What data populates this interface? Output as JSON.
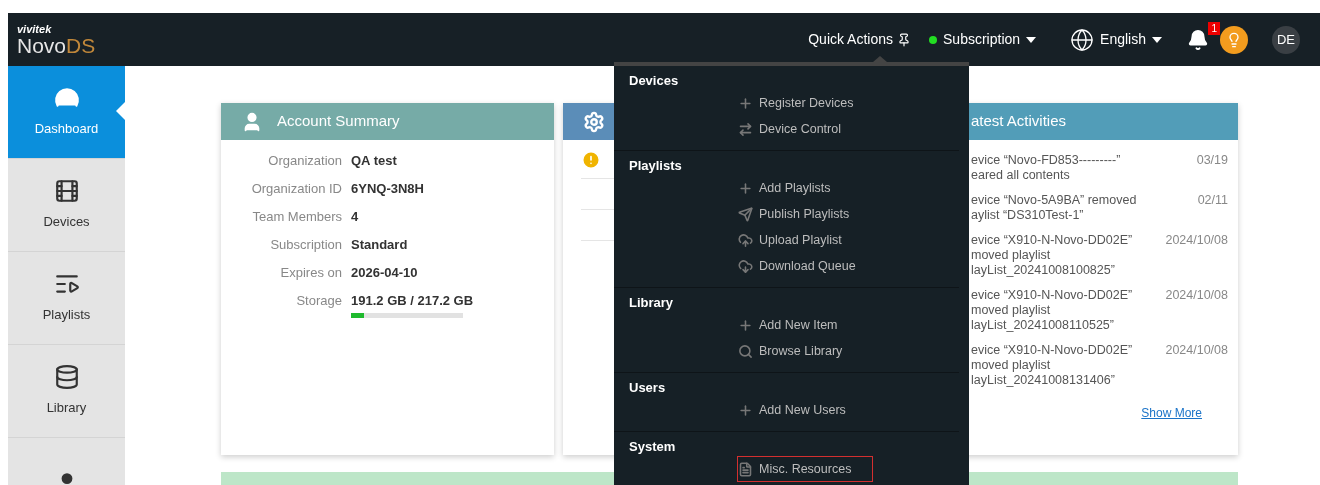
{
  "header": {
    "logo_top": "vivitek",
    "logo_main": "Novo",
    "logo_accent": "DS",
    "quick_actions": "Quick Actions",
    "subscription": "Subscription",
    "language": "English",
    "notification_count": "1",
    "user_initials": "DE"
  },
  "sidebar": {
    "items": [
      {
        "label": "Dashboard",
        "selected": true
      },
      {
        "label": "Devices",
        "selected": false
      },
      {
        "label": "Playlists",
        "selected": false
      },
      {
        "label": "Library",
        "selected": false
      },
      {
        "selected": false
      }
    ]
  },
  "account_summary": {
    "title": "Account Summary",
    "fields": [
      {
        "label": "Organization",
        "value": "QA test"
      },
      {
        "label": "Organization ID",
        "value": "6YNQ-3N8H"
      },
      {
        "label": "Team Members",
        "value": "4"
      },
      {
        "label": "Subscription",
        "value": "Standard"
      },
      {
        "label": "Expires on",
        "value": "2026-04-10"
      },
      {
        "label": "Storage",
        "value": "191.2 GB / 217.2 GB",
        "level": 0.12
      }
    ]
  },
  "latest_activities": {
    "title": "atest Activities",
    "items": [
      {
        "text": "evice “Novo-FD853---------”\neared all contents",
        "date": "03/19"
      },
      {
        "text": "evice “Novo-5A9BA” removed\naylist “DS310Test-1”",
        "date": "02/11"
      },
      {
        "text": "evice “X910-N-Novo-DD02E”\nmoved playlist\nlayList_20241008100825”",
        "date": "2024/10/08"
      },
      {
        "text": "evice “X910-N-Novo-DD02E”\nmoved playlist\nlayList_20241008110525”",
        "date": "2024/10/08"
      },
      {
        "text": "evice “X910-N-Novo-DD02E”\nmoved playlist\nlayList_20241008131406”",
        "date": "2024/10/08"
      }
    ],
    "show_more": "Show More"
  },
  "quick_actions_menu": {
    "sections": [
      {
        "title": "Devices",
        "items": [
          {
            "kind": "plus",
            "label": "Register Devices",
            "highlighted": false
          },
          {
            "kind": "control",
            "label": "Device Control",
            "highlighted": false
          }
        ]
      },
      {
        "title": "Playlists",
        "items": [
          {
            "kind": "plus",
            "label": "Add Playlists",
            "highlighted": false
          },
          {
            "kind": "publish",
            "label": "Publish Playlists",
            "highlighted": false
          },
          {
            "kind": "upload",
            "label": "Upload Playlist",
            "highlighted": false
          },
          {
            "kind": "download",
            "label": "Download Queue",
            "highlighted": false
          }
        ]
      },
      {
        "title": "Library",
        "items": [
          {
            "kind": "plus",
            "label": "Add New Item",
            "highlighted": false
          },
          {
            "kind": "search",
            "label": "Browse Library",
            "highlighted": false
          }
        ]
      },
      {
        "title": "Users",
        "items": [
          {
            "kind": "plus",
            "label": "Add New Users",
            "highlighted": false
          }
        ]
      },
      {
        "title": "System",
        "items": [
          {
            "kind": "document",
            "label": "Misc. Resources",
            "highlighted": true
          }
        ]
      }
    ]
  }
}
